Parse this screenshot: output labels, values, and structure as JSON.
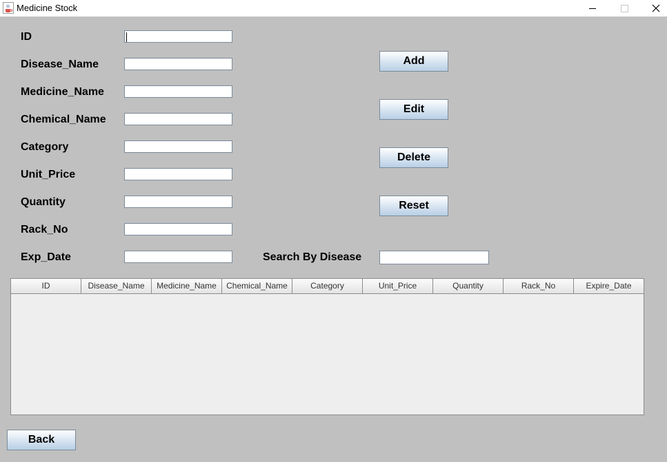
{
  "window": {
    "title": "Medicine Stock",
    "app_icon": "java-cup-icon"
  },
  "form": {
    "fields": [
      {
        "label": "ID",
        "value": ""
      },
      {
        "label": "Disease_Name",
        "value": ""
      },
      {
        "label": "Medicine_Name",
        "value": ""
      },
      {
        "label": "Chemical_Name",
        "value": ""
      },
      {
        "label": "Category",
        "value": ""
      },
      {
        "label": "Unit_Price",
        "value": ""
      },
      {
        "label": "Quantity",
        "value": ""
      },
      {
        "label": "Rack_No",
        "value": ""
      },
      {
        "label": "Exp_Date",
        "value": ""
      }
    ]
  },
  "actions": {
    "add": "Add",
    "edit": "Edit",
    "delete": "Delete",
    "reset": "Reset"
  },
  "search": {
    "label": "Search By Disease",
    "value": ""
  },
  "table": {
    "columns": [
      "ID",
      "Disease_Name",
      "Medicine_Name",
      "Chemical_Name",
      "Category",
      "Unit_Price",
      "Quantity",
      "Rack_No",
      "Expire_Date"
    ],
    "rows": []
  },
  "footer": {
    "back": "Back"
  }
}
